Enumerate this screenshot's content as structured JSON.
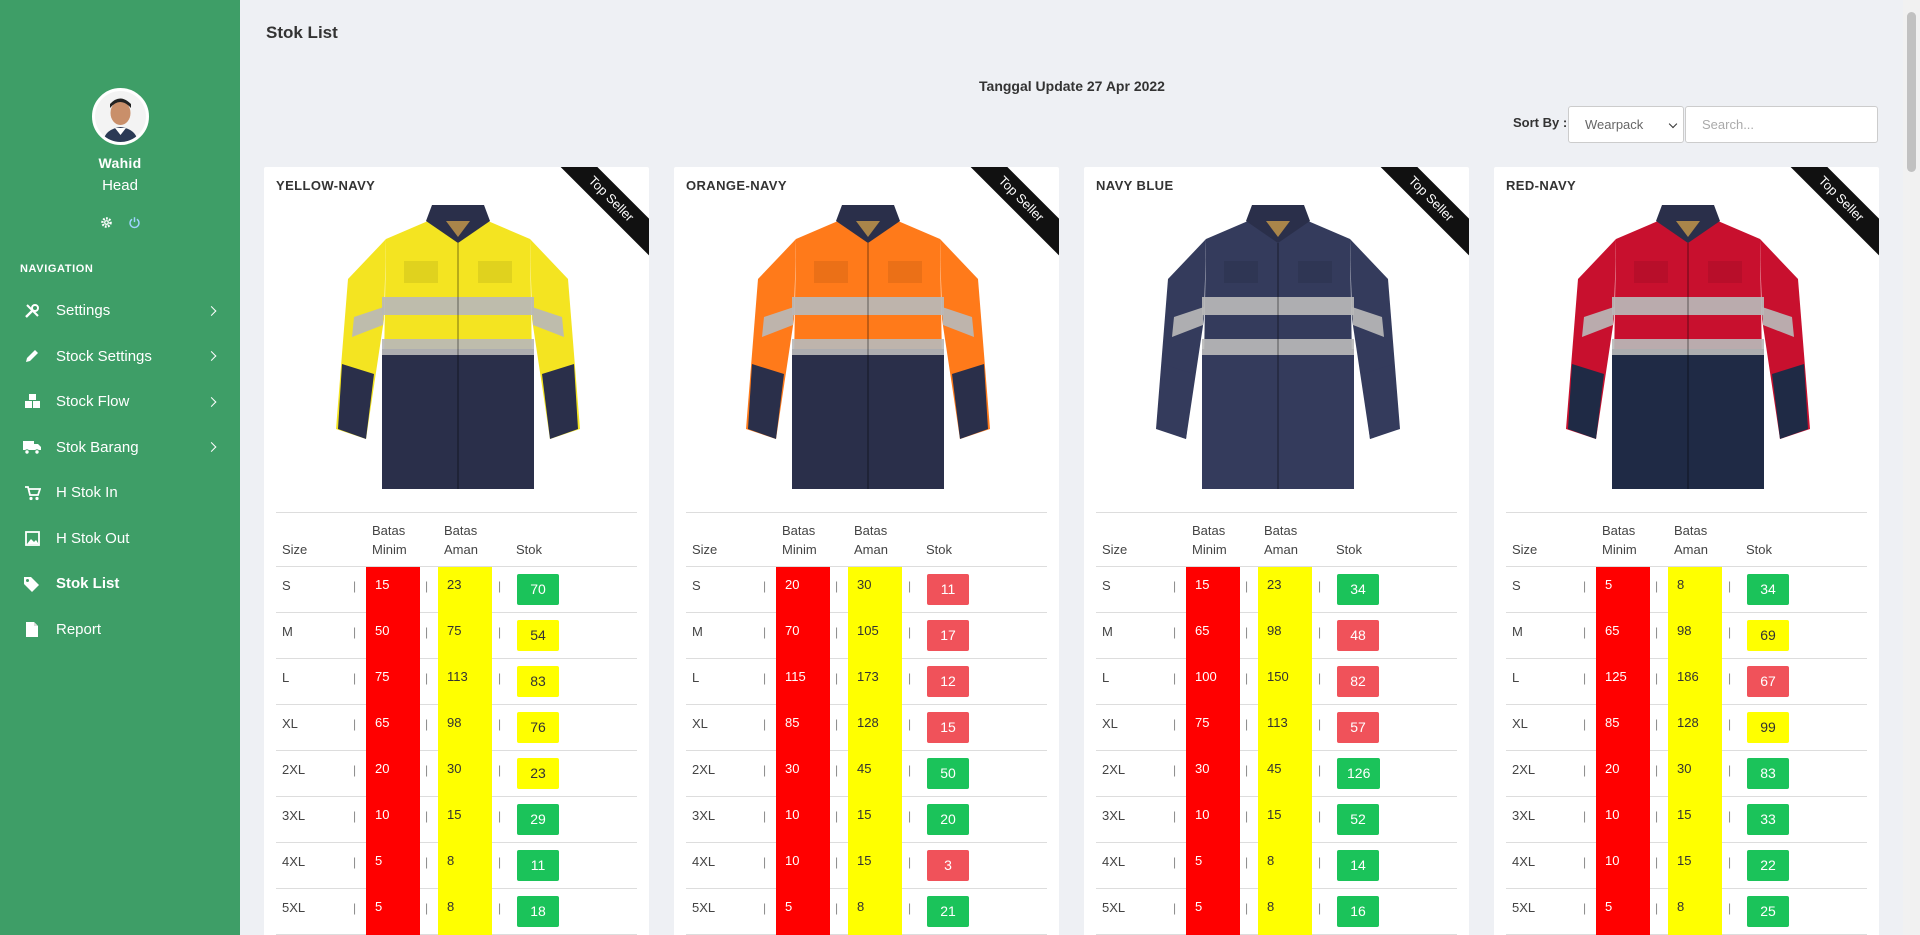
{
  "user": {
    "name": "Wahid",
    "role": "Head"
  },
  "nav": {
    "title": "NAVIGATION",
    "items": [
      {
        "label": "Settings",
        "icon": "tools-icon",
        "has_submenu": true
      },
      {
        "label": "Stock Settings",
        "icon": "pencil-icon",
        "has_submenu": true
      },
      {
        "label": "Stock Flow",
        "icon": "cube-icon",
        "has_submenu": true
      },
      {
        "label": "Stok Barang",
        "icon": "truck-icon",
        "has_submenu": true
      },
      {
        "label": "H Stok In",
        "icon": "cart-icon",
        "has_submenu": false
      },
      {
        "label": "H Stok Out",
        "icon": "image-icon",
        "has_submenu": false
      },
      {
        "label": "Stok List",
        "icon": "tags-icon",
        "has_submenu": false,
        "active": true
      },
      {
        "label": "Report",
        "icon": "document-icon",
        "has_submenu": false
      }
    ]
  },
  "page": {
    "title": "Stok List",
    "update_date": "Tanggal Update 27 Apr 2022",
    "sort_label": "Sort By :",
    "sort_value": "Wearpack",
    "search_placeholder": "Search..."
  },
  "table_headers": {
    "size": "Size",
    "min_line1": "Batas",
    "min_line2": "Minim",
    "aman_line1": "Batas",
    "aman_line2": "Aman",
    "stok": "Stok"
  },
  "colors": {
    "sidebar": "#3e9e67",
    "min": "#ff0000",
    "aman": "#ffff00",
    "stok_green": "#1bc35a",
    "stok_yellow": "#ffff00",
    "stok_red": "#f0525a"
  },
  "products": [
    {
      "name": "YELLOW-NAVY",
      "badge": "Top Seller",
      "top_color": "#f4e421",
      "bottom_color": "#2a2f4a",
      "rows": [
        {
          "size": "S",
          "min": "15",
          "aman": "23",
          "stok": "70",
          "status": "green"
        },
        {
          "size": "M",
          "min": "50",
          "aman": "75",
          "stok": "54",
          "status": "yellow"
        },
        {
          "size": "L",
          "min": "75",
          "aman": "113",
          "stok": "83",
          "status": "yellow"
        },
        {
          "size": "XL",
          "min": "65",
          "aman": "98",
          "stok": "76",
          "status": "yellow"
        },
        {
          "size": "2XL",
          "min": "20",
          "aman": "30",
          "stok": "23",
          "status": "yellow"
        },
        {
          "size": "3XL",
          "min": "10",
          "aman": "15",
          "stok": "29",
          "status": "green"
        },
        {
          "size": "4XL",
          "min": "5",
          "aman": "8",
          "stok": "11",
          "status": "green"
        },
        {
          "size": "5XL",
          "min": "5",
          "aman": "8",
          "stok": "18",
          "status": "green"
        }
      ]
    },
    {
      "name": "ORANGE-NAVY",
      "badge": "Top Seller",
      "top_color": "#ff7a1a",
      "bottom_color": "#2a2f4a",
      "rows": [
        {
          "size": "S",
          "min": "20",
          "aman": "30",
          "stok": "11",
          "status": "red"
        },
        {
          "size": "M",
          "min": "70",
          "aman": "105",
          "stok": "17",
          "status": "red"
        },
        {
          "size": "L",
          "min": "115",
          "aman": "173",
          "stok": "12",
          "status": "red"
        },
        {
          "size": "XL",
          "min": "85",
          "aman": "128",
          "stok": "15",
          "status": "red"
        },
        {
          "size": "2XL",
          "min": "30",
          "aman": "45",
          "stok": "50",
          "status": "green"
        },
        {
          "size": "3XL",
          "min": "10",
          "aman": "15",
          "stok": "20",
          "status": "green"
        },
        {
          "size": "4XL",
          "min": "10",
          "aman": "15",
          "stok": "3",
          "status": "red"
        },
        {
          "size": "5XL",
          "min": "5",
          "aman": "8",
          "stok": "21",
          "status": "green"
        }
      ]
    },
    {
      "name": "NAVY BLUE",
      "badge": "Top Seller",
      "top_color": "#343b5c",
      "bottom_color": "#343b5c",
      "rows": [
        {
          "size": "S",
          "min": "15",
          "aman": "23",
          "stok": "34",
          "status": "green"
        },
        {
          "size": "M",
          "min": "65",
          "aman": "98",
          "stok": "48",
          "status": "red"
        },
        {
          "size": "L",
          "min": "100",
          "aman": "150",
          "stok": "82",
          "status": "red"
        },
        {
          "size": "XL",
          "min": "75",
          "aman": "113",
          "stok": "57",
          "status": "red"
        },
        {
          "size": "2XL",
          "min": "30",
          "aman": "45",
          "stok": "126",
          "status": "green"
        },
        {
          "size": "3XL",
          "min": "10",
          "aman": "15",
          "stok": "52",
          "status": "green"
        },
        {
          "size": "4XL",
          "min": "5",
          "aman": "8",
          "stok": "14",
          "status": "green"
        },
        {
          "size": "5XL",
          "min": "5",
          "aman": "8",
          "stok": "16",
          "status": "green"
        }
      ]
    },
    {
      "name": "RED-NAVY",
      "badge": "Top Seller",
      "top_color": "#c8102e",
      "bottom_color": "#1f2a45",
      "rows": [
        {
          "size": "S",
          "min": "5",
          "aman": "8",
          "stok": "34",
          "status": "green"
        },
        {
          "size": "M",
          "min": "65",
          "aman": "98",
          "stok": "69",
          "status": "yellow"
        },
        {
          "size": "L",
          "min": "125",
          "aman": "186",
          "stok": "67",
          "status": "red"
        },
        {
          "size": "XL",
          "min": "85",
          "aman": "128",
          "stok": "99",
          "status": "yellow"
        },
        {
          "size": "2XL",
          "min": "20",
          "aman": "30",
          "stok": "83",
          "status": "green"
        },
        {
          "size": "3XL",
          "min": "10",
          "aman": "15",
          "stok": "33",
          "status": "green"
        },
        {
          "size": "4XL",
          "min": "10",
          "aman": "15",
          "stok": "22",
          "status": "green"
        },
        {
          "size": "5XL",
          "min": "5",
          "aman": "8",
          "stok": "25",
          "status": "green"
        }
      ]
    }
  ]
}
